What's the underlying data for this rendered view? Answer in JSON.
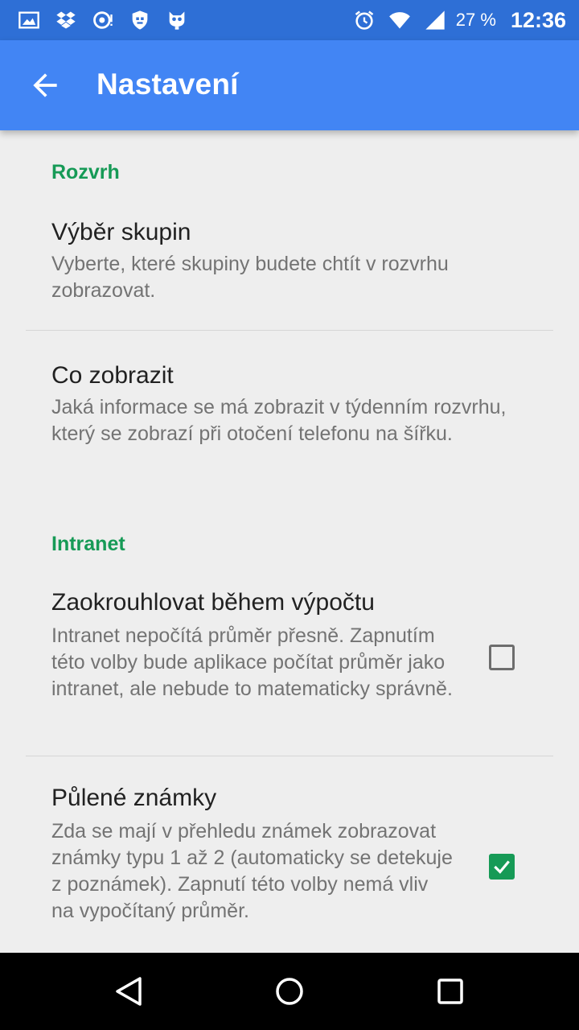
{
  "status_bar": {
    "icons_left": [
      "image-icon",
      "dropbox-icon",
      "notification-icon",
      "shield-icon",
      "cat-icon"
    ],
    "battery_text": "27 %",
    "time": "12:36"
  },
  "app_bar": {
    "title": "Nastavení",
    "back_icon": "arrow-left-icon",
    "color": "#4285f4"
  },
  "sections": [
    {
      "header": "Rozvrh",
      "items": [
        {
          "title": "Výběr skupin",
          "summary": "Vyberte, které skupiny budete chtít v rozvrhu zobrazovat."
        },
        {
          "title": "Co zobrazit",
          "summary": "Jaká informace se má zobrazit v týdenním rozvrhu, který se zobrazí při otočení telefonu na šířku."
        }
      ]
    },
    {
      "header": "Intranet",
      "items": [
        {
          "title": "Zaokrouhlovat během výpočtu",
          "summary": "Intranet nepočítá průměr přesně. Zapnutím této volby bude aplikace počítat průměr jako intranet, ale nebude to matematicky správně.",
          "checked": false
        },
        {
          "title": "Půlené známky",
          "summary": "Zda se mají v přehledu známek zobrazovat známky typu 1 až 2 (automaticky se detekuje z poznámek). Zapnutí této volby nemá vliv na vypočítaný průměr.",
          "checked": true
        }
      ]
    }
  ],
  "accent_color": "#169a56",
  "nav_bar": {
    "icons": [
      "back-triangle-icon",
      "home-circle-icon",
      "recents-square-icon"
    ]
  }
}
